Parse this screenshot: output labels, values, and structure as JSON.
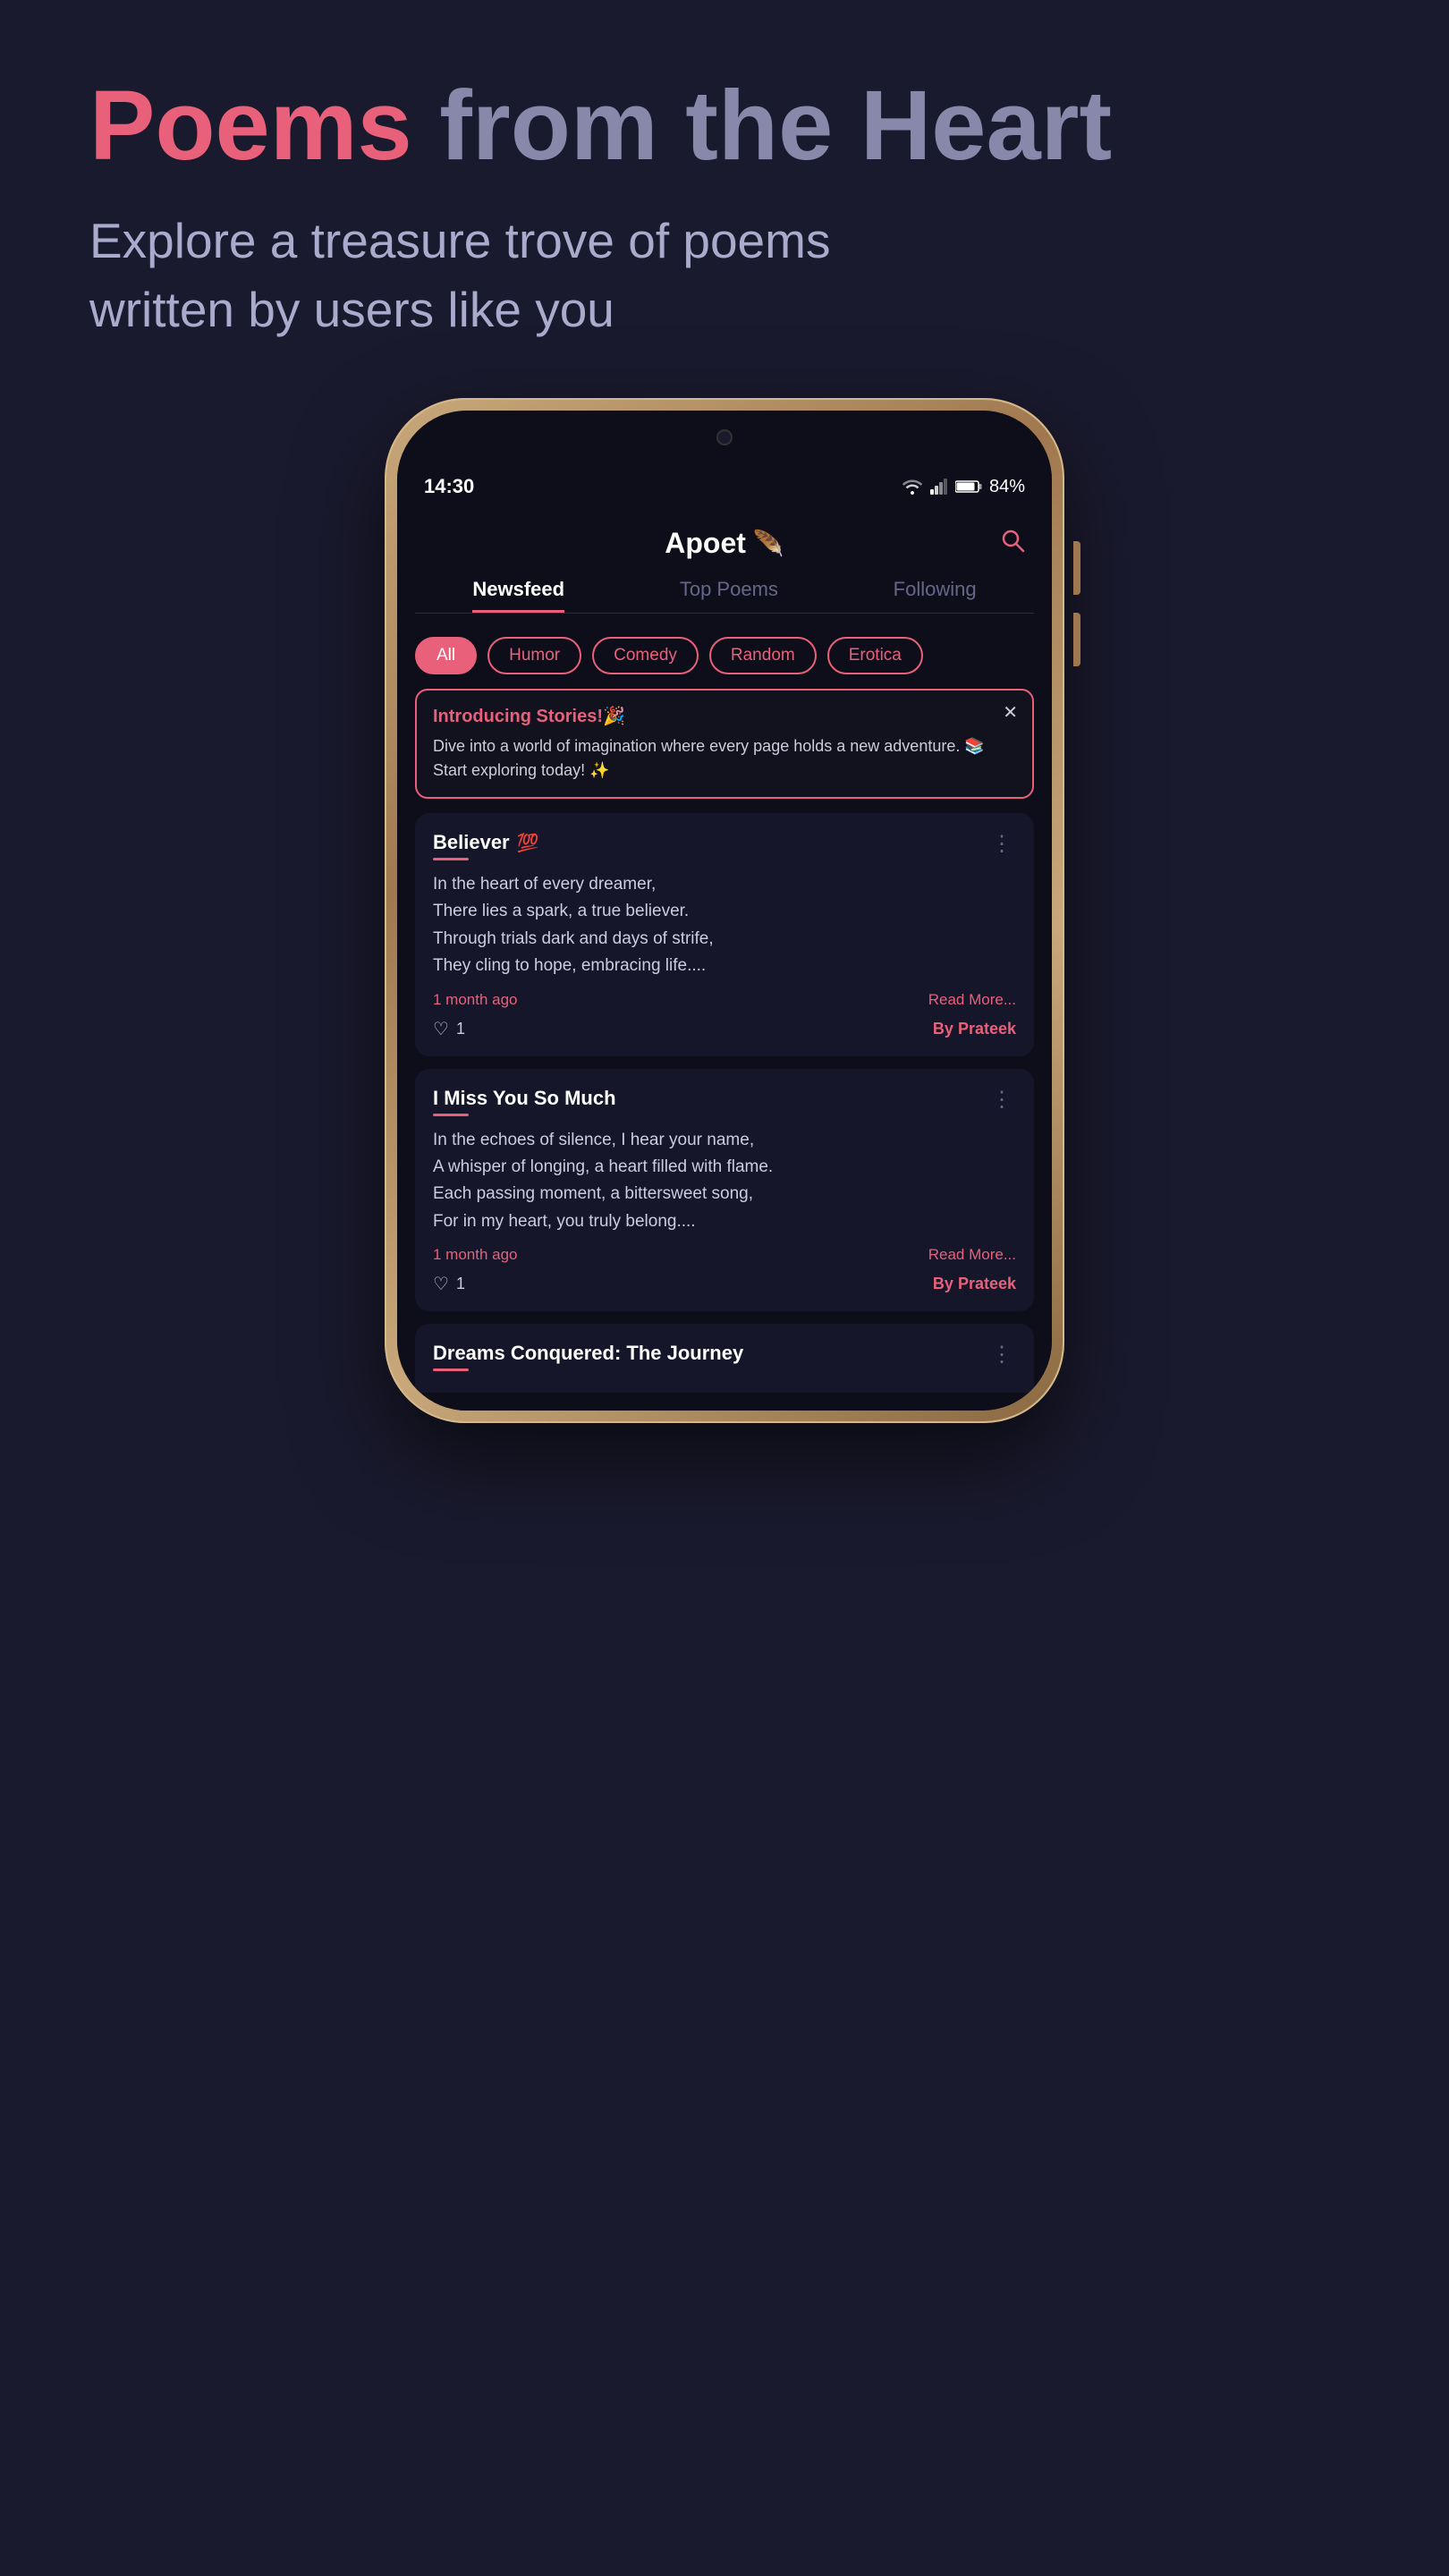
{
  "hero": {
    "title_highlight": "Poems",
    "title_rest": " from the Heart",
    "subtitle": "Explore a treasure trove of poems written by users like you"
  },
  "status_bar": {
    "time": "14:30",
    "battery": "84%"
  },
  "app": {
    "name": "Apoet",
    "logo_emoji": "🪶"
  },
  "tabs": [
    {
      "label": "Newsfeed",
      "active": true
    },
    {
      "label": "Top Poems",
      "active": false
    },
    {
      "label": "Following",
      "active": false
    }
  ],
  "filters": [
    {
      "label": "All",
      "active": true
    },
    {
      "label": "Humor",
      "active": false
    },
    {
      "label": "Comedy",
      "active": false
    },
    {
      "label": "Random",
      "active": false
    },
    {
      "label": "Erotica",
      "active": false
    }
  ],
  "banner": {
    "title": "Introducing Stories!🎉",
    "text": "Dive into a world of imagination where every page holds a new adventure. 📚 Start exploring today! ✨"
  },
  "poems": [
    {
      "title": "Believer",
      "title_emoji": "💯",
      "body": "In the heart of every dreamer,\nThere lies a spark, a true believer.\nThrough trials dark and days of strife,\nThey cling to hope, embracing life....",
      "time": "1 month ago",
      "likes": "1",
      "author": "Prateek"
    },
    {
      "title": "I Miss You So Much",
      "title_emoji": "",
      "body": "In the echoes of silence, I hear your name,\nA whisper of longing, a heart filled with flame.\nEach passing moment, a bittersweet song,\nFor in my heart, you truly belong....",
      "time": "1 month ago",
      "likes": "1",
      "author": "Prateek"
    },
    {
      "title": "Dreams Conquered: The Journey",
      "title_emoji": "",
      "body": "",
      "time": "",
      "likes": "",
      "author": ""
    }
  ],
  "labels": {
    "read_more": "Read More...",
    "by": "By",
    "menu_dots": "⋮",
    "close": "✕"
  }
}
